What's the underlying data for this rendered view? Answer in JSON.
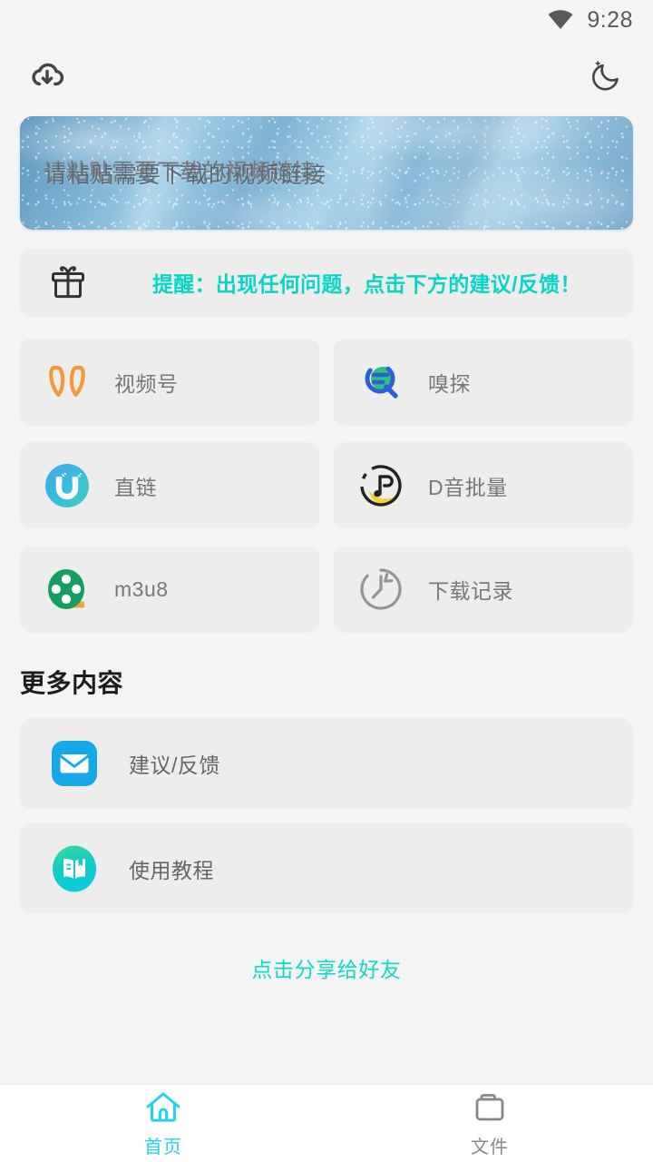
{
  "status_bar": {
    "time": "9:28",
    "wifi_icon": "wifi-icon"
  },
  "app_bar": {
    "download_icon": "cloud-download-icon",
    "theme_icon": "moon-icon"
  },
  "paste_input": {
    "placeholder": "请粘贴需要下载的视频链接",
    "value": ""
  },
  "notice": {
    "icon": "gift-icon",
    "text": "提醒：出现任何问题，点击下方的建议/反馈！",
    "color": "#06d6c3"
  },
  "features": [
    {
      "label": "视频号",
      "icon": "wechat-channels-icon"
    },
    {
      "label": "嗅探",
      "icon": "sniffer-search-icon"
    },
    {
      "label": "直链",
      "icon": "magnet-link-icon"
    },
    {
      "label": "D音批量",
      "icon": "douyin-music-icon"
    },
    {
      "label": "m3u8",
      "icon": "film-reel-icon"
    },
    {
      "label": "下载记录",
      "icon": "history-clock-icon"
    }
  ],
  "more": {
    "title": "更多内容",
    "items": [
      {
        "label": "建议/反馈",
        "icon": "mail-envelope-icon"
      },
      {
        "label": "使用教程",
        "icon": "open-book-icon"
      }
    ]
  },
  "share": {
    "label": "点击分享给好友",
    "color": "#0fd9cb"
  },
  "tabbar": {
    "active_color": "#22d3ee",
    "inactive_color": "#888888",
    "items": [
      {
        "label": "首页",
        "icon": "home-icon",
        "active": true
      },
      {
        "label": "文件",
        "icon": "folder-icon",
        "active": false
      }
    ]
  }
}
